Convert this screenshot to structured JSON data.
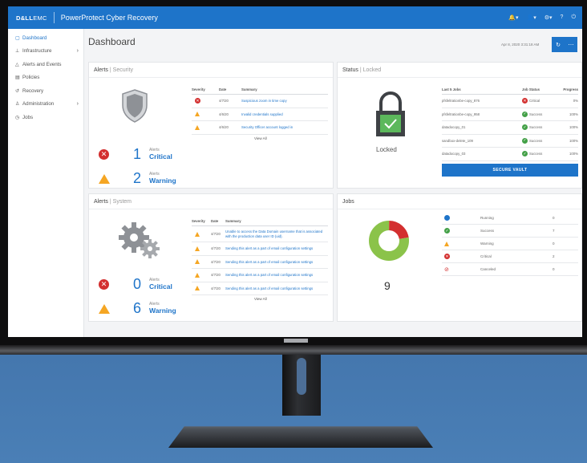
{
  "topbar": {
    "brand_bold": "D&LL",
    "brand_light": "EMC",
    "product": "PowerProtect Cyber Recovery",
    "icons": [
      "bell-icon",
      "user-icon",
      "gear-icon",
      "help-icon",
      "power-icon"
    ]
  },
  "sidebar": {
    "items": [
      {
        "label": "Dashboard",
        "icon": "dashboard-icon"
      },
      {
        "label": "Infrastructure",
        "icon": "infrastructure-icon",
        "chevron": true
      },
      {
        "label": "Alerts and Events",
        "icon": "alert-icon"
      },
      {
        "label": "Policies",
        "icon": "policies-icon"
      },
      {
        "label": "Recovery",
        "icon": "recovery-icon"
      },
      {
        "label": "Administration",
        "icon": "admin-icon",
        "chevron": true
      },
      {
        "label": "Jobs",
        "icon": "jobs-icon"
      }
    ]
  },
  "main": {
    "title": "Dashboard",
    "datetime": "Apr 8, 2020 3:31:18 AM",
    "refresh_icon": "refresh-icon",
    "more_icon": "more-icon"
  },
  "alerts_security": {
    "title": "Alerts",
    "subtitle": "Security",
    "columns": [
      "Severity",
      "Date",
      "Summary"
    ],
    "rows": [
      {
        "severity": "critical",
        "date": "4/7/20",
        "summary": "Suspicious zoom in time copy"
      },
      {
        "severity": "warning",
        "date": "4/6/20",
        "summary": "Invalid credentials supplied"
      },
      {
        "severity": "warning",
        "date": "4/6/20",
        "summary": "Security Officer account logged in"
      }
    ],
    "view_all": "View All",
    "critical": {
      "count": "1",
      "label": "Alerts",
      "type": "Critical"
    },
    "warning": {
      "count": "2",
      "label": "Alerts",
      "type": "Warning"
    }
  },
  "status": {
    "title": "Status",
    "subtitle": "Locked",
    "lock_label": "Locked",
    "columns": [
      "Last 5 Jobs",
      "Job Status",
      "Progress"
    ],
    "rows": [
      {
        "job": "pfsfeltrationbe-copy_876",
        "status": "Critical",
        "kind": "critical",
        "progress": "0%"
      },
      {
        "job": "pfsfeltrationbe-copy_958",
        "status": "Success",
        "kind": "success",
        "progress": "100%"
      },
      {
        "job": "datadocopy_01",
        "status": "Success",
        "kind": "success",
        "progress": "100%"
      },
      {
        "job": "sandbox-delete_109",
        "status": "Success",
        "kind": "success",
        "progress": "100%"
      },
      {
        "job": "datadocopy_03",
        "status": "Success",
        "kind": "success",
        "progress": "100%"
      }
    ],
    "secure_button": "SECURE VAULT"
  },
  "alerts_system": {
    "title": "Alerts",
    "subtitle": "System",
    "columns": [
      "Severity",
      "Date",
      "Summary"
    ],
    "rows": [
      {
        "date": "4/7/20",
        "summary": "Unable to access the Data Domain username that is associated with the production data user ID (uid)."
      },
      {
        "date": "4/7/20",
        "summary": "Sending this alert as a part of email configuration settings"
      },
      {
        "date": "4/7/20",
        "summary": "Sending this alert as a part of email configuration settings"
      },
      {
        "date": "4/7/20",
        "summary": "Sending this alert as a part of email configuration settings"
      },
      {
        "date": "4/7/20",
        "summary": "Sending this alert as a part of email configuration settings"
      }
    ],
    "view_all": "View All",
    "critical": {
      "count": "0",
      "label": "Alerts",
      "type": "Critical"
    },
    "warning": {
      "count": "6",
      "label": "Alerts",
      "type": "Warning"
    }
  },
  "jobs": {
    "title": "Jobs",
    "total": "9",
    "rows": [
      {
        "label": "Running",
        "count": "0",
        "icon": "running-icon"
      },
      {
        "label": "Success",
        "count": "7",
        "icon": "success-icon"
      },
      {
        "label": "Warning",
        "count": "0",
        "icon": "warning-icon"
      },
      {
        "label": "Critical",
        "count": "2",
        "icon": "critical-icon"
      },
      {
        "label": "Canceled",
        "count": "0",
        "icon": "canceled-icon"
      }
    ],
    "donut": {
      "success": 7,
      "critical": 2,
      "success_color": "#8bc34a",
      "critical_color": "#d32f2f"
    }
  },
  "colors": {
    "accent": "#1e74c9",
    "warning": "#f5a623",
    "critical": "#d32f2f",
    "success": "#43a047"
  }
}
